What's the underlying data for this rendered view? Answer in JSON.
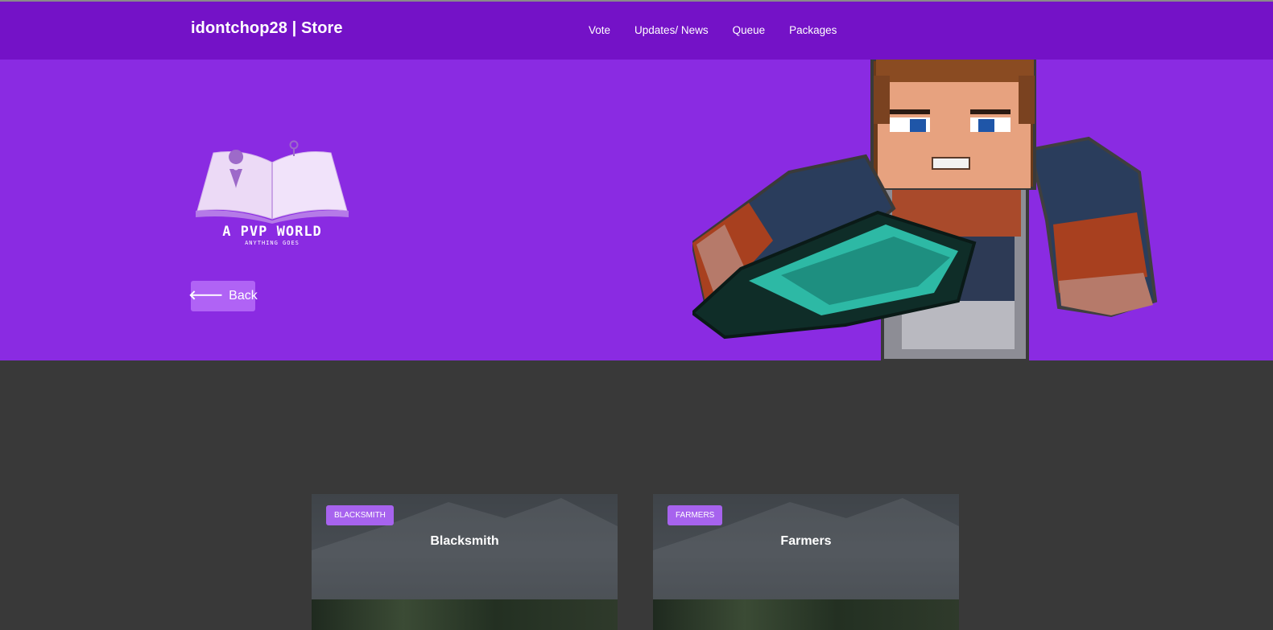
{
  "header": {
    "brand": "idontchop28 | Store",
    "nav": [
      {
        "label": "Vote"
      },
      {
        "label": "Updates/ News"
      },
      {
        "label": "Queue"
      },
      {
        "label": "Packages"
      }
    ]
  },
  "hero": {
    "logo_title": "A PVP WORLD",
    "logo_subtitle": "ANYTHING GOES",
    "back_label": "Back"
  },
  "cards": [
    {
      "badge": "BLACKSMITH",
      "title": "Blacksmith"
    },
    {
      "badge": "FARMERS",
      "title": "Farmers"
    }
  ],
  "colors": {
    "topbar": "#7412c7",
    "hero": "#8a2be2",
    "body": "#393939",
    "accent": "#a763ee"
  }
}
